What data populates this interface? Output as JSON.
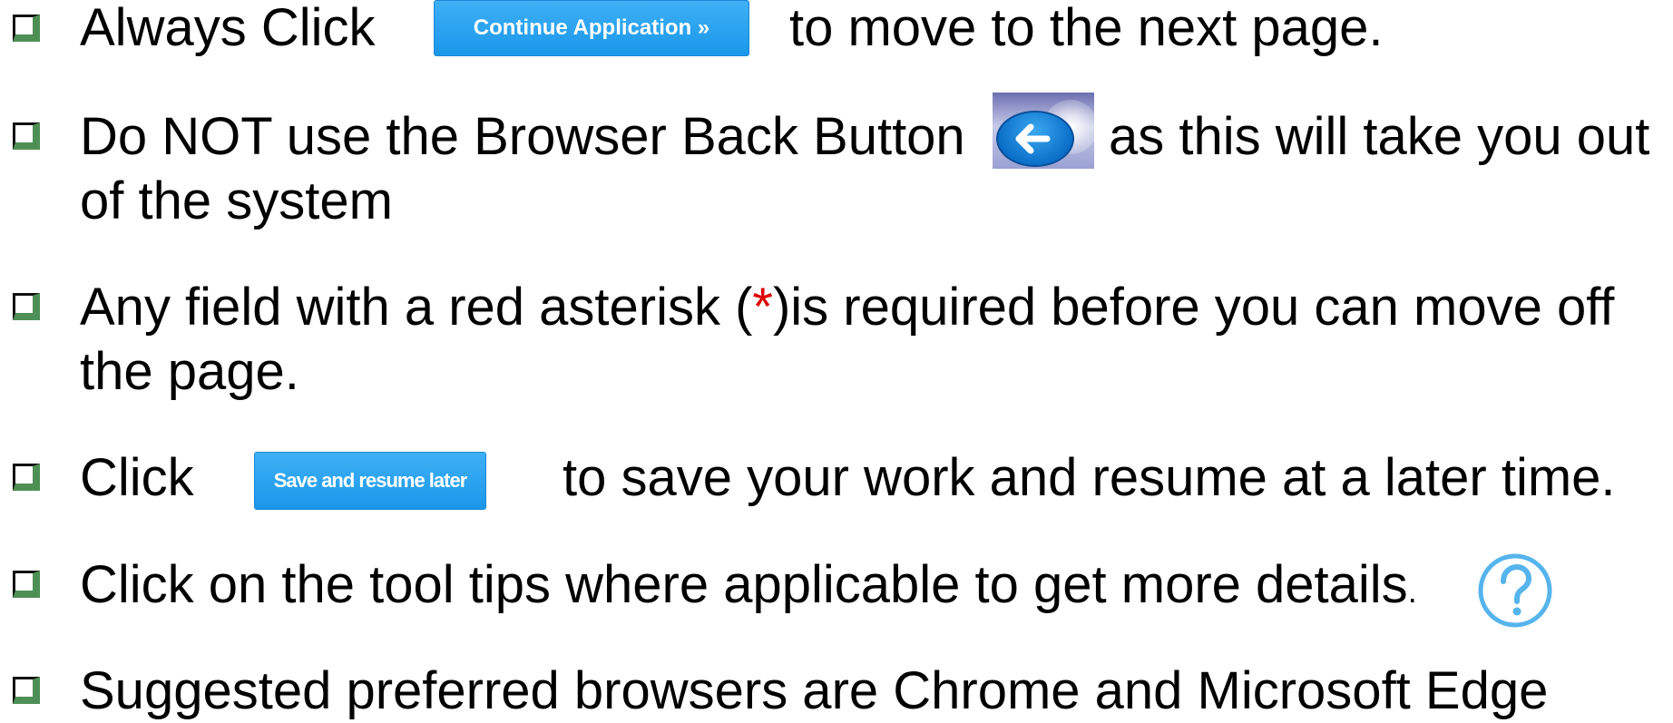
{
  "items": [
    {
      "before": "Always Click",
      "button_label": "Continue Application »",
      "after": "to move to the next page."
    },
    {
      "before": "Do NOT use the Browser Back Button",
      "after": "as this will take you out",
      "line2": "of the system",
      "icon": "back-arrow-icon"
    },
    {
      "before": "Any field with a red asterisk (",
      "asterisk": "*",
      "after": ")is required before you can move off",
      "line2": "the page."
    },
    {
      "before": "Click",
      "button_label": "Save and resume later",
      "after": "to save your work and resume at a later time."
    },
    {
      "before": "Click on the tool tips where applicable to get more details",
      "period": ".",
      "icon": "help-question-icon"
    },
    {
      "before": "Suggested preferred browsers are Chrome and Microsoft Edge"
    }
  ],
  "colors": {
    "button_blue": "#1a97ea",
    "bullet_green": "#4e8f55",
    "asterisk_red": "#e00000",
    "help_icon_blue": "#56b4ec"
  }
}
